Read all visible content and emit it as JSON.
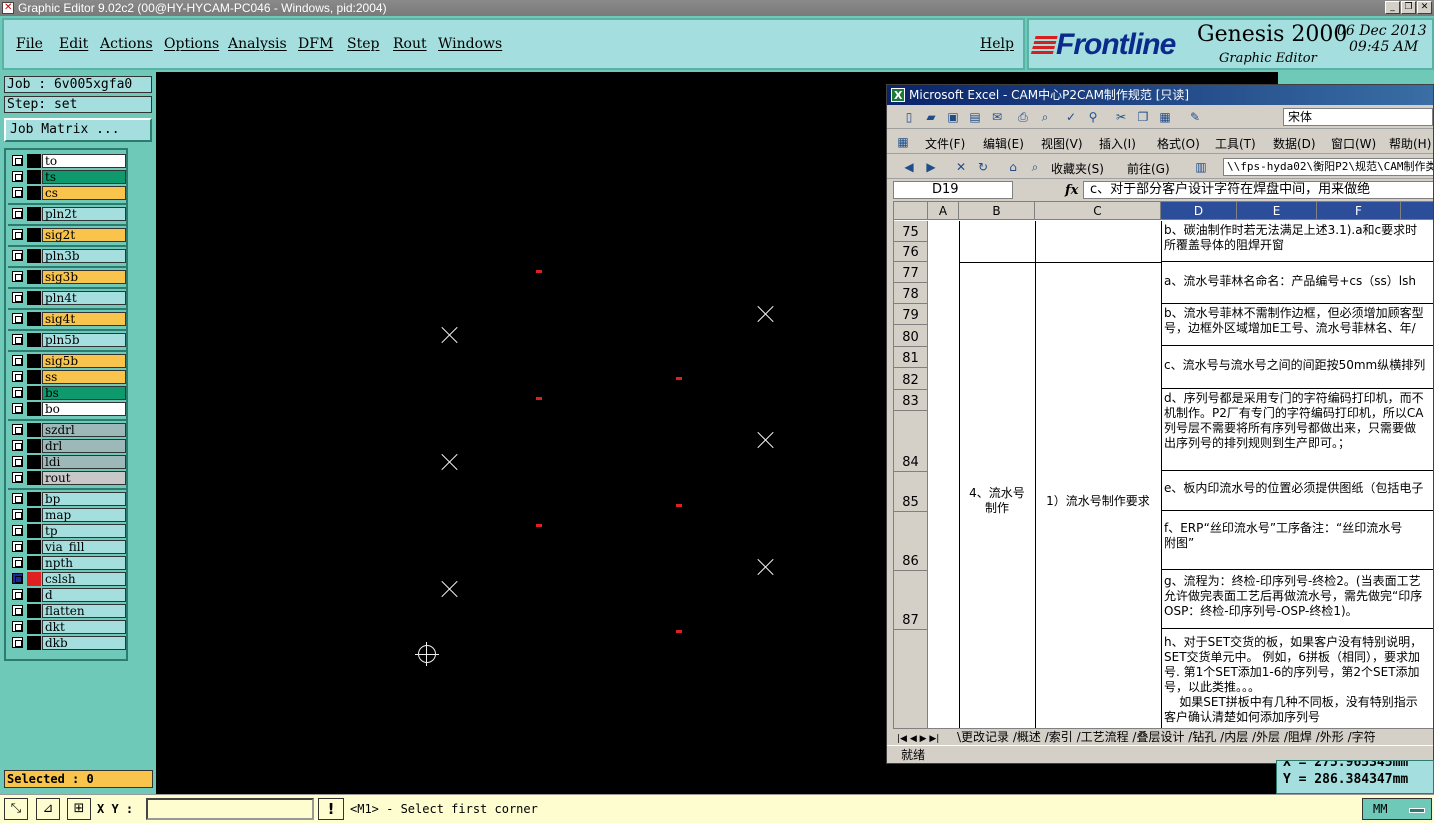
{
  "window": {
    "title": "Graphic Editor 9.02c2 (00@HY-HYCAM-PC046 - Windows, pid:2004)",
    "buttons": [
      "_",
      "❐",
      "✕"
    ]
  },
  "menu": {
    "items": [
      "File",
      "Edit",
      "Actions",
      "Options",
      "Analysis",
      "DFM",
      "Step",
      "Rout",
      "Windows"
    ],
    "help": "Help"
  },
  "brand": {
    "logo": "Frontline",
    "product": "Genesis 2000",
    "subtitle": "Graphic Editor",
    "date": "06 Dec 2013",
    "time": "09:45 AM"
  },
  "job": {
    "job_line": "Job : 6v005xgfa0",
    "step_line": "Step: set",
    "matrix_button": "Job Matrix ..."
  },
  "layers": [
    {
      "name": "to",
      "color": "#ffffff",
      "group": 1
    },
    {
      "name": "ts",
      "color": "#0f9a6e",
      "group": 1
    },
    {
      "name": "cs",
      "color": "#f8c44b",
      "group": 1
    },
    {
      "name": "pln2t",
      "color": "#a4dede",
      "group": 2
    },
    {
      "name": "sig2t",
      "color": "#f8c44b",
      "group": 3
    },
    {
      "name": "pln3b",
      "color": "#a4dede",
      "group": 4
    },
    {
      "name": "sig3b",
      "color": "#f8c44b",
      "group": 5
    },
    {
      "name": "pln4t",
      "color": "#a4dede",
      "group": 6
    },
    {
      "name": "sig4t",
      "color": "#f8c44b",
      "group": 7
    },
    {
      "name": "pln5b",
      "color": "#a4dede",
      "group": 8
    },
    {
      "name": "sig5b",
      "color": "#f8c44b",
      "group": 9
    },
    {
      "name": "ss",
      "color": "#f8c44b",
      "group": 9
    },
    {
      "name": "bs",
      "color": "#0f9a6e",
      "group": 9
    },
    {
      "name": "bo",
      "color": "#ffffff",
      "group": 9
    },
    {
      "name": "szdrl",
      "color": "#9cb8b8",
      "group": 10
    },
    {
      "name": "drl",
      "color": "#9cb8b8",
      "group": 10
    },
    {
      "name": "ldi",
      "color": "#9cb8b8",
      "group": 10
    },
    {
      "name": "rout",
      "color": "#c8c8c8",
      "group": 10
    },
    {
      "name": "bp",
      "color": "#a4dede",
      "group": 11
    },
    {
      "name": "map",
      "color": "#a4dede",
      "group": 11
    },
    {
      "name": "tp",
      "color": "#a4dede",
      "group": 11
    },
    {
      "name": "via_fill",
      "color": "#a4dede",
      "group": 11
    },
    {
      "name": "npth",
      "color": "#a4dede",
      "group": 11
    },
    {
      "name": "cslsh",
      "color": "#a4dede",
      "group": 11,
      "active": true
    },
    {
      "name": "d",
      "color": "#a4dede",
      "group": 11
    },
    {
      "name": "flatten",
      "color": "#a4dede",
      "group": 11
    },
    {
      "name": "dkt",
      "color": "#a4dede",
      "group": 11
    },
    {
      "name": "dkb",
      "color": "#a4dede",
      "group": 11
    }
  ],
  "selected": "Selected : 0",
  "excel": {
    "title": "Microsoft Excel - CAM中心P2CAM制作规范 [只读]",
    "font": "宋体",
    "menu": [
      "文件(F)",
      "编辑(E)",
      "视图(V)",
      "插入(I)",
      "格式(O)",
      "工具(T)",
      "数据(D)",
      "窗口(W)",
      "帮助(H)"
    ],
    "favorites": "收藏夹(S)",
    "goto": "前往(G)",
    "address": "\\\\fps-hyda02\\衡阳P2\\规范\\CAM制作类\\",
    "name_box": "D19",
    "fx": "fx",
    "formula": "c、对于部分客户设计字符在焊盘中间，用来做绝",
    "columns": [
      "A",
      "B",
      "C",
      "D",
      "E",
      "F"
    ],
    "rows": [
      {
        "num": "75"
      },
      {
        "num": "76"
      },
      {
        "num": "77"
      },
      {
        "num": "78"
      },
      {
        "num": "79"
      },
      {
        "num": "80"
      },
      {
        "num": "81"
      },
      {
        "num": "82"
      },
      {
        "num": "83"
      },
      {
        "num": "84"
      },
      {
        "num": "85"
      },
      {
        "num": "86"
      },
      {
        "num": "87"
      }
    ],
    "b_merged": "4、流水号\n制作",
    "c_merged": "1）流水号制作要求",
    "d_cells": [
      "b、碳油制作时若无法满足上述3.1).a和c要求时\n所覆盖导体的阻焊开窗",
      "a、流水号菲林名命名：产品编号+cs（ss）lsh",
      "b、流水号菲林不需制作边框，但必须增加顾客型\n号，边框外区域增加E工号、流水号菲林名、年/",
      "c、流水号与流水号之间的间距按50mm纵横排列",
      "d、序列号都是采用专门的字符编码打印机，而不\n机制作。P2厂有专门的字符编码打印机，所以CA\n列号层不需要将所有序列号都做出来，只需要做\n出序列号的排列规则到生产即可。；",
      "e、板内印流水号的位置必须提供图纸（包括电子",
      "f、ERP“丝印流水号”工序备注：“丝印流水号\n附图”",
      "g、流程为：终检-印序列号-终检2。(当表面工艺\n允许做完表面工艺后再做流水号，需先做完“印序\nOSP：终检-印序列号-OSP-终检1)。",
      "h、对于SET交货的板，如果客户没有特别说明，\nSET交货单元中。 例如，6拼板（相同），要求加\n号. 第1个SET添加1-6的序列号，第2个SET添加\n号，以此类推。。。\n    如果SET拼板中有几种不同板，没有特别指示\n客户确认清楚如何添加序列号"
    ],
    "sheet_tabs": "\\更改记录 /概述 /索引 /工艺流程 /叠层设计 /钻孔 /内层 /外层 /阻焊 /外形 /字符",
    "status": "就绪"
  },
  "coords": {
    "x": "X = 275.965345mm",
    "y": "Y = 286.384347mm"
  },
  "bottom": {
    "xy_label": "X Y :",
    "xy_value": "",
    "warn": "!",
    "prompt": "<M1> - Select first corner",
    "units": "MM"
  },
  "colors": {
    "panel": "#6fc9b9",
    "menubar": "#a4dede",
    "canvas": "#000000",
    "feature_red": "#e02020",
    "selected_bg": "#f8c44b"
  }
}
